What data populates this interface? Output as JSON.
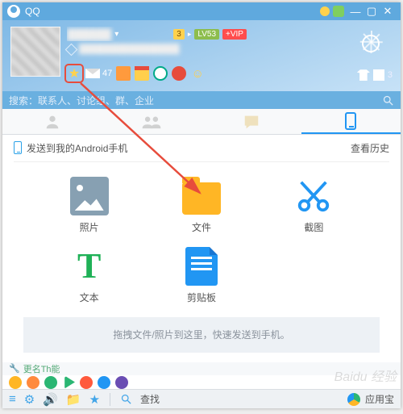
{
  "title": "QQ",
  "sys": {
    "min": "—",
    "max": "▢",
    "close": "✕"
  },
  "user": {
    "nick": "██████",
    "badge_num": "3",
    "level": "LV53",
    "vip": "+VIP",
    "mail_count": "47",
    "tshirt_count": "3"
  },
  "search": {
    "text": "搜索：联系人、讨论组、群、企业"
  },
  "content_head": {
    "device": "发送到我的Android手机",
    "history": "查看历史"
  },
  "grid": {
    "photo": "照片",
    "file": "文件",
    "screenshot": "截图",
    "text": "文本",
    "clip": "剪贴板"
  },
  "dropzone": "拖拽文件/照片到这里，快速发送到手机。",
  "strip1": "更名Th能",
  "bottom": {
    "findlabel": "查找",
    "appbao": "应用宝"
  },
  "watermark": "Baidu 经验"
}
